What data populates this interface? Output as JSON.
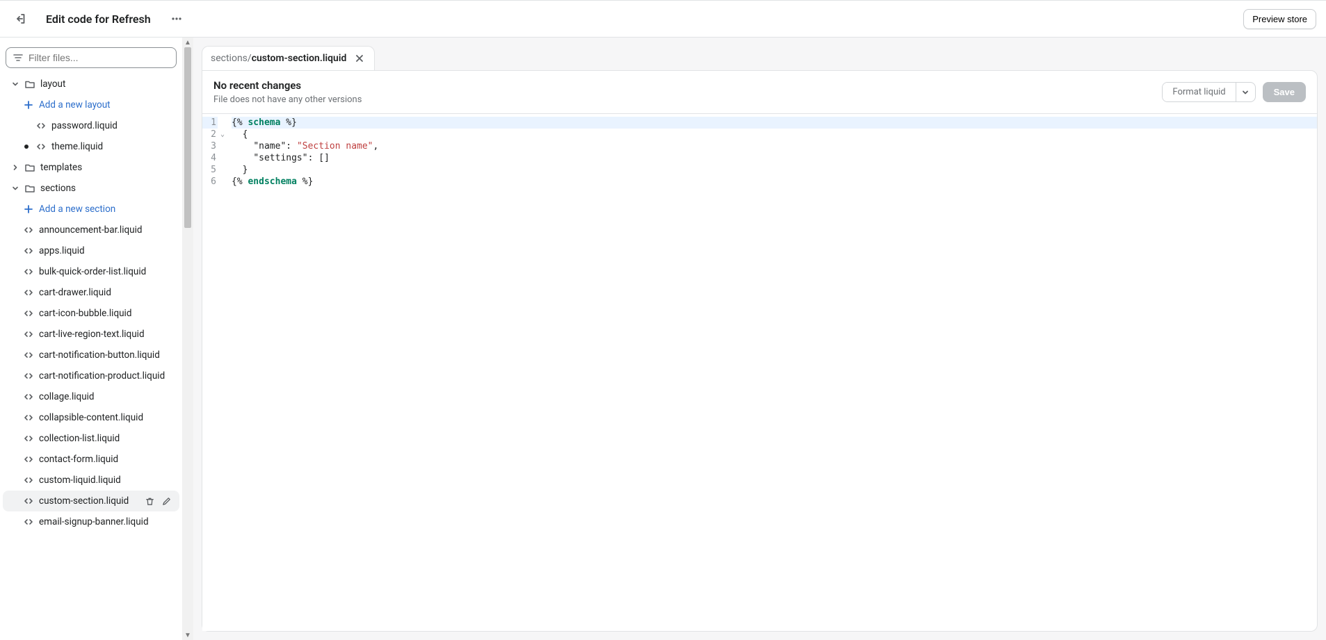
{
  "header": {
    "title": "Edit code for Refresh",
    "preview_button": "Preview store"
  },
  "filter": {
    "placeholder": "Filter files..."
  },
  "sidebar": {
    "folders": [
      {
        "name": "layout",
        "expanded": true,
        "add_label": "Add a new layout",
        "files": [
          {
            "name": "password.liquid",
            "modified": false
          },
          {
            "name": "theme.liquid",
            "modified": true
          }
        ]
      },
      {
        "name": "templates",
        "expanded": false
      },
      {
        "name": "sections",
        "expanded": true,
        "add_label": "Add a new section",
        "files": [
          {
            "name": "announcement-bar.liquid"
          },
          {
            "name": "apps.liquid"
          },
          {
            "name": "bulk-quick-order-list.liquid"
          },
          {
            "name": "cart-drawer.liquid"
          },
          {
            "name": "cart-icon-bubble.liquid"
          },
          {
            "name": "cart-live-region-text.liquid"
          },
          {
            "name": "cart-notification-button.liquid"
          },
          {
            "name": "cart-notification-product.liquid"
          },
          {
            "name": "collage.liquid"
          },
          {
            "name": "collapsible-content.liquid"
          },
          {
            "name": "collection-list.liquid"
          },
          {
            "name": "contact-form.liquid"
          },
          {
            "name": "custom-liquid.liquid"
          },
          {
            "name": "custom-section.liquid",
            "selected": true,
            "actions": true
          },
          {
            "name": "email-signup-banner.liquid"
          }
        ]
      }
    ]
  },
  "tab": {
    "dir": "sections/",
    "file": "custom-section.liquid"
  },
  "file_meta": {
    "title": "No recent changes",
    "subtitle": "File does not have any other versions",
    "format_label": "Format liquid",
    "save_label": "Save"
  },
  "code": {
    "lines": [
      {
        "n": 1,
        "highlight": true,
        "tokens": [
          [
            "delim",
            "{%"
          ],
          [
            "text",
            " "
          ],
          [
            "keyword",
            "schema"
          ],
          [
            "text",
            " "
          ],
          [
            "delim",
            "%}"
          ]
        ]
      },
      {
        "n": 2,
        "fold": true,
        "tokens": [
          [
            "text",
            "  "
          ],
          [
            "punc",
            "{"
          ]
        ]
      },
      {
        "n": 3,
        "tokens": [
          [
            "text",
            "    "
          ],
          [
            "key",
            "\"name\""
          ],
          [
            "punc",
            ":"
          ],
          [
            "text",
            " "
          ],
          [
            "string",
            "\"Section name\""
          ],
          [
            "punc",
            ","
          ]
        ]
      },
      {
        "n": 4,
        "tokens": [
          [
            "text",
            "    "
          ],
          [
            "key",
            "\"settings\""
          ],
          [
            "punc",
            ":"
          ],
          [
            "text",
            " "
          ],
          [
            "punc",
            "[]"
          ]
        ]
      },
      {
        "n": 5,
        "tokens": [
          [
            "text",
            "  "
          ],
          [
            "punc",
            "}"
          ]
        ]
      },
      {
        "n": 6,
        "tokens": [
          [
            "delim",
            "{%"
          ],
          [
            "text",
            " "
          ],
          [
            "keyword",
            "endschema"
          ],
          [
            "text",
            " "
          ],
          [
            "delim",
            "%}"
          ]
        ]
      }
    ]
  }
}
